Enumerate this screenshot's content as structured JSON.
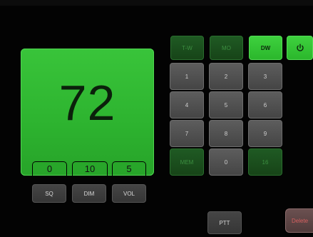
{
  "display": {
    "channel": "72",
    "sq_value": "0",
    "dim_value": "10",
    "vol_value": "5"
  },
  "controls": {
    "sq_label": "SQ",
    "dim_label": "DIM",
    "vol_label": "VOL"
  },
  "function_keys": {
    "tw": "T-W",
    "mo": "MO",
    "dw": "DW",
    "power_icon": "power-icon"
  },
  "keypad": {
    "k1": "1",
    "k2": "2",
    "k3": "3",
    "k4": "4",
    "k5": "5",
    "k6": "6",
    "k7": "7",
    "k8": "8",
    "k9": "9",
    "k0": "0",
    "left_action": "MEM",
    "right_action": "16"
  },
  "bottom": {
    "ptt": "PTT",
    "delete": "Delete"
  },
  "colors": {
    "display_green": "#2db32f",
    "bright_green": "#3ed13e",
    "dark_green": "#1f5a23",
    "key_gray": "#505050"
  }
}
